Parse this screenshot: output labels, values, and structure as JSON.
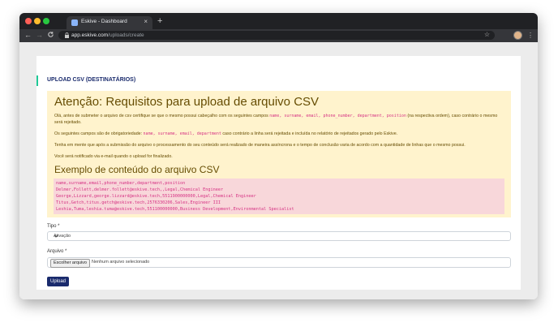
{
  "browser": {
    "tab_title": "Eskive - Dashboard",
    "tab_close": "×",
    "new_tab": "+",
    "url_host": "app.eskive.com",
    "url_path": "/uploads/create",
    "back": "←",
    "forward": "→",
    "reload": "C",
    "star": "☆",
    "menu": "⋮"
  },
  "page": {
    "section_title": "UPLOAD CSV (DESTINATÁRIOS)",
    "alert": {
      "heading": "Atenção: Requisitos para upload de arquivo CSV",
      "p1_before": "Olá, antes de submeter o arquivo de csv certifique se que o mesmo possui cabeçalho com os seguintes campos ",
      "p1_fields": "name, surname, email, phone_number, department, position",
      "p1_after": " (na respectiva ordem), caso contrário o mesmo será rejeitado.",
      "p2_before": "Os seguintes campos são de obrigatoriedade: ",
      "p2_fields": "name, surname, email, department",
      "p2_after": " caso contrário a linha será rejeitada e incluída no relatório de rejeitados gerado pelo Eskive.",
      "p3": "Tenha em mente que após a submissão do arquivo o processamento do seu conteúdo será realizado de maneira assíncrona e o tempo de conclusão varia de acordo com a quantidade de linhas que o mesmo possui.",
      "p4": "Você será notificado via e-mail quando o upload for finalizado.",
      "example_heading": "Exemplo de conteúdo do arquivo CSV",
      "example_lines": [
        "name,surname,email,phone_number,department,position",
        "Delmer,Follett,delmer.follett@eskive.tech,,Legal,Chemical Engineer",
        "George,Lizzard,george.lizzard@eskive.tech,5511900000000,Legal,Chemical Engineer",
        "Titus,Getch,titus.getch@eskive.tech,2576330206,Sales,Engineer III",
        "Leshia,Tuma,leshia.tuma@eskive.tech,551100000000,Business Development,Environmental Specialist"
      ]
    },
    "form": {
      "type_label": "Tipo *",
      "type_value": "Ativação",
      "file_label": "Arquivo *",
      "file_button": "Escolher arquivo",
      "file_status": "Nenhum arquivo selecionado",
      "submit_label": "Upload"
    }
  }
}
